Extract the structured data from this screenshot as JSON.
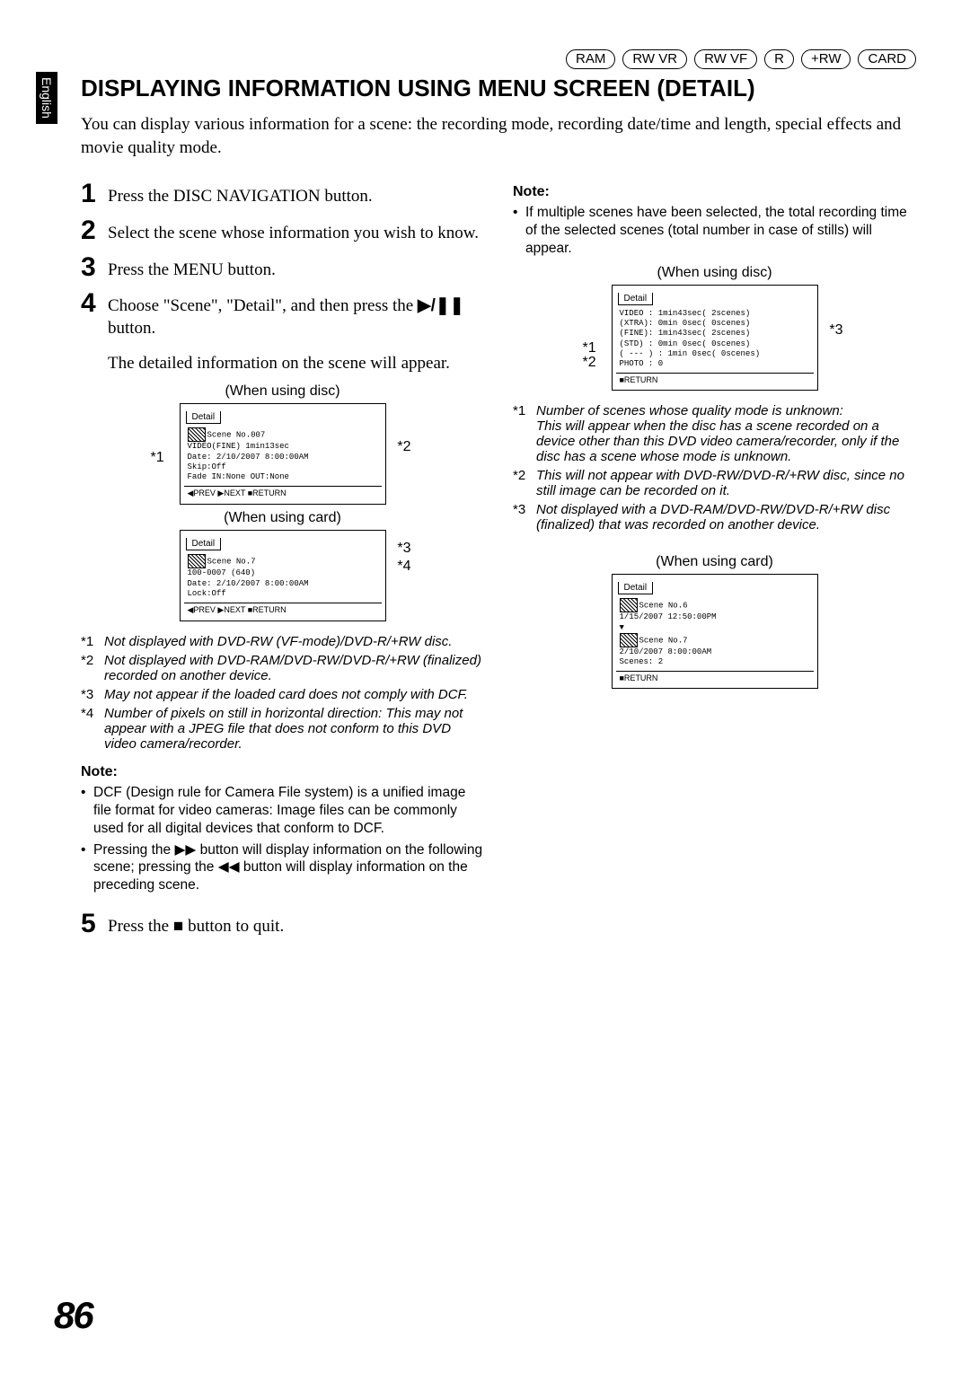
{
  "lang_tab": "English",
  "badges": [
    "RAM",
    "RW VR",
    "RW VF",
    "R",
    "+RW",
    "CARD"
  ],
  "heading": "DISPLAYING INFORMATION USING MENU SCREEN (DETAIL)",
  "intro": "You can display various information for a scene: the recording mode, recording date/time and length, special effects and movie quality mode.",
  "steps": {
    "s1": "Press the DISC NAVIGATION button.",
    "s2": "Select the scene whose information you wish to know.",
    "s3": "Press the MENU button.",
    "s4a": "Choose \"Scene\", \"Detail\", and then press the ",
    "s4b": " button.",
    "s4_after": "The detailed information on the scene will appear.",
    "s5a": "Press the ",
    "s5b": " button to quit."
  },
  "icons": {
    "play_pause": "▶/❚❚",
    "stop": "■",
    "ffwd": "▶▶",
    "rew": "◀◀"
  },
  "left_disc_caption": "(When using disc)",
  "left_card_caption": "(When using card)",
  "lcd_disc_left": {
    "title": "Detail",
    "lines": [
      "Scene No.007",
      "VIDEO(FINE)   1min13sec",
      "Date: 2/10/2007  8:00:00AM",
      "Skip:Off",
      "Fade IN:None OUT:None"
    ],
    "foot": "◀PREV  ▶NEXT  ■RETURN"
  },
  "lcd_card_left": {
    "title": "Detail",
    "lines": [
      "Scene No.7",
      "100-0007 (640)",
      "Date: 2/10/2007  8:00:00AM",
      "Lock:Off"
    ],
    "foot": "◀PREV  ▶NEXT  ■RETURN"
  },
  "left_tags": {
    "t1": "*1",
    "t2": "*2",
    "t3": "*3",
    "t4": "*4"
  },
  "left_annots": [
    {
      "k": "*1",
      "v": "Not displayed with DVD-RW (VF-mode)/DVD-R/+RW disc."
    },
    {
      "k": "*2",
      "v": "Not displayed with DVD-RAM/DVD-RW/DVD-R/+RW (finalized) recorded on another device."
    },
    {
      "k": "*3",
      "v": "May not appear if the loaded card does not comply with DCF."
    },
    {
      "k": "*4",
      "v": "Number of pixels on still in horizontal direction: This may not appear with a JPEG file that does not conform to this DVD video camera/recorder."
    }
  ],
  "left_note_h": "Note:",
  "left_notes": [
    "DCF (Design rule for Camera File system) is a unified image file format for video cameras: Image files can be commonly used for all digital devices that conform to DCF.",
    "Pressing the ▶▶ button will display information on the following scene; pressing the ◀◀ button will display information on the preceding scene."
  ],
  "right_note_h": "Note:",
  "right_note": "If multiple scenes have been selected, the total recording time of the selected scenes (total number in case of stills) will appear.",
  "right_disc_caption": "(When using disc)",
  "lcd_disc_right": {
    "title": "Detail",
    "lines": [
      "VIDEO : 1min43sec( 2scenes)",
      "(XTRA): 0min 0sec( 0scenes)",
      "(FINE): 1min43sec( 2scenes)",
      "(STD) : 0min 0sec( 0scenes)",
      "( --- ) : 1min 0sec( 0scenes)",
      "PHOTO : 0"
    ],
    "foot": "■RETURN"
  },
  "right_tags": {
    "t1": "*1",
    "t2": "*2",
    "t3": "*3"
  },
  "right_annots": [
    {
      "k": "*1",
      "v": "Number of scenes whose quality mode is unknown:\nThis will appear when the disc has a scene recorded on a device other than this DVD video camera/recorder, only if the disc has a scene whose mode is unknown."
    },
    {
      "k": "*2",
      "v": "This will not appear with DVD-RW/DVD-R/+RW disc, since no still image can be recorded on it."
    },
    {
      "k": "*3",
      "v": "Not displayed with a DVD-RAM/DVD-RW/DVD-R/+RW disc (finalized) that was recorded on another device."
    }
  ],
  "right_card_caption": "(When using card)",
  "lcd_card_right": {
    "title": "Detail",
    "lines": [
      "Scene No.6",
      "   1/15/2007 12:50:00PM",
      "▼",
      "Scene No.7",
      "   2/10/2007  8:00:00AM",
      "Scenes: 2"
    ],
    "foot": "■RETURN"
  },
  "page_number": "86"
}
